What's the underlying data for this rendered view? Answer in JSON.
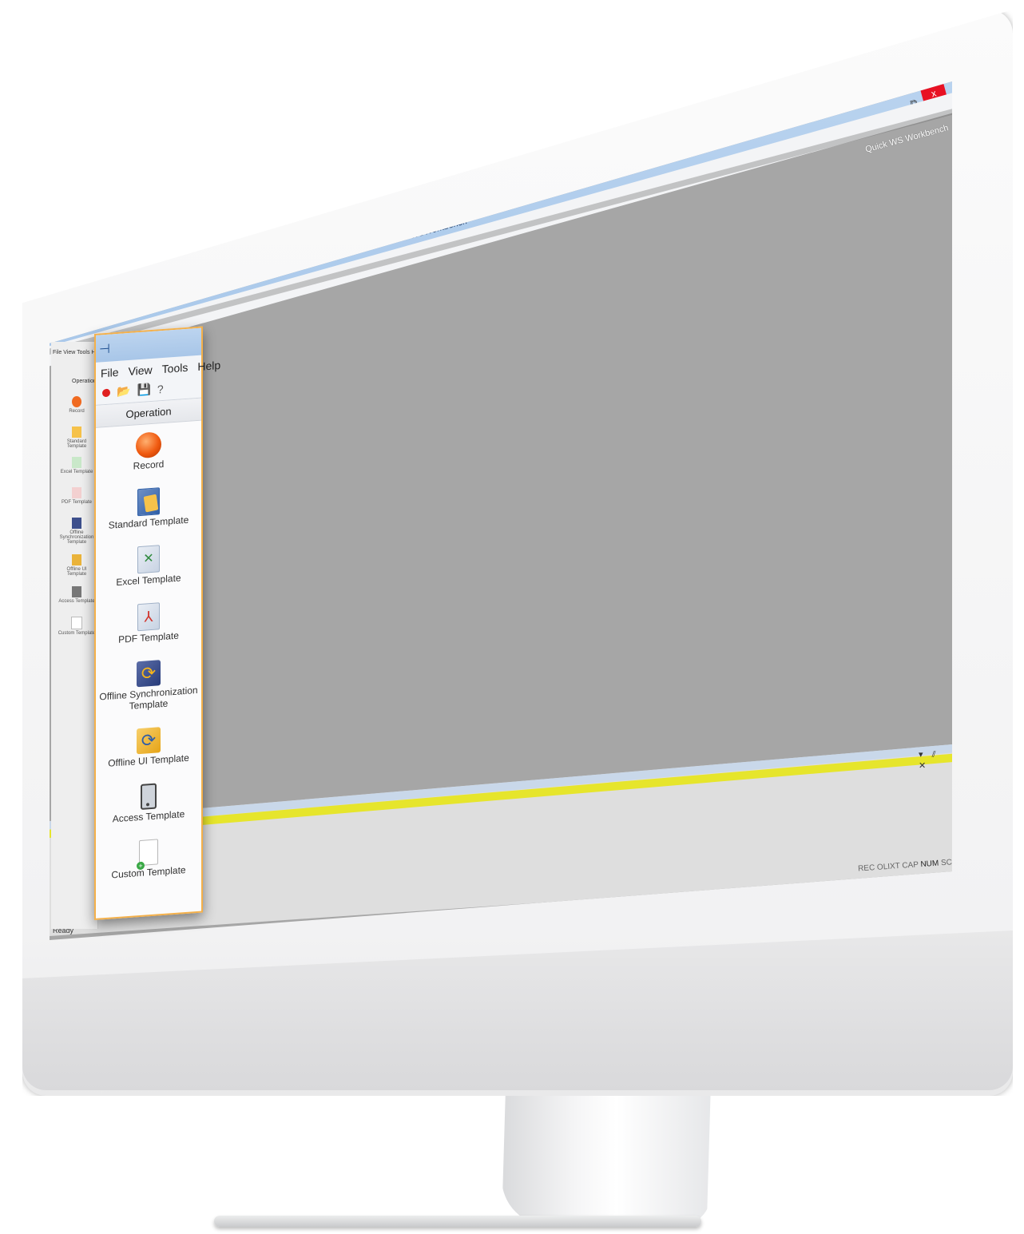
{
  "window": {
    "title": "WSWorkbench",
    "brand": "Quick WS Workbench",
    "minimize_glyph": "_",
    "maximize_glyph": "⧉",
    "close_glyph": "x"
  },
  "sidebar": {
    "menu": [
      "File",
      "View",
      "Tools",
      "Help"
    ],
    "toolbar_icons": [
      "record-icon",
      "open-folder-icon",
      "save-icon",
      "help-icon"
    ],
    "header": "Operation",
    "items": [
      {
        "label": "Record",
        "icon": "record-icon"
      },
      {
        "label": "Standard Template",
        "icon": "standard-template-icon"
      },
      {
        "label": "Excel Template",
        "icon": "excel-template-icon"
      },
      {
        "label": "PDF Template",
        "icon": "pdf-template-icon"
      },
      {
        "label": "Offline Synchronization Template",
        "icon": "sync-template-icon"
      },
      {
        "label": "Offline UI Template",
        "icon": "offline-ui-template-icon"
      },
      {
        "label": "Access Template",
        "icon": "access-template-icon"
      },
      {
        "label": "Custom Template",
        "icon": "custom-template-icon"
      }
    ]
  },
  "output_pane": {
    "controls": "▾ ⫽ ✕"
  },
  "status": {
    "left": "Ready",
    "indicators": [
      "REC",
      "OLIXT",
      "CAP",
      "NUM",
      "SCRL"
    ]
  },
  "colors": {
    "accent_border": "#f4b04a",
    "title_bar": "#b9d3ef",
    "workspace": "#a6a6a6",
    "output_highlight": "#e6e52c",
    "close_button": "#e81123"
  }
}
